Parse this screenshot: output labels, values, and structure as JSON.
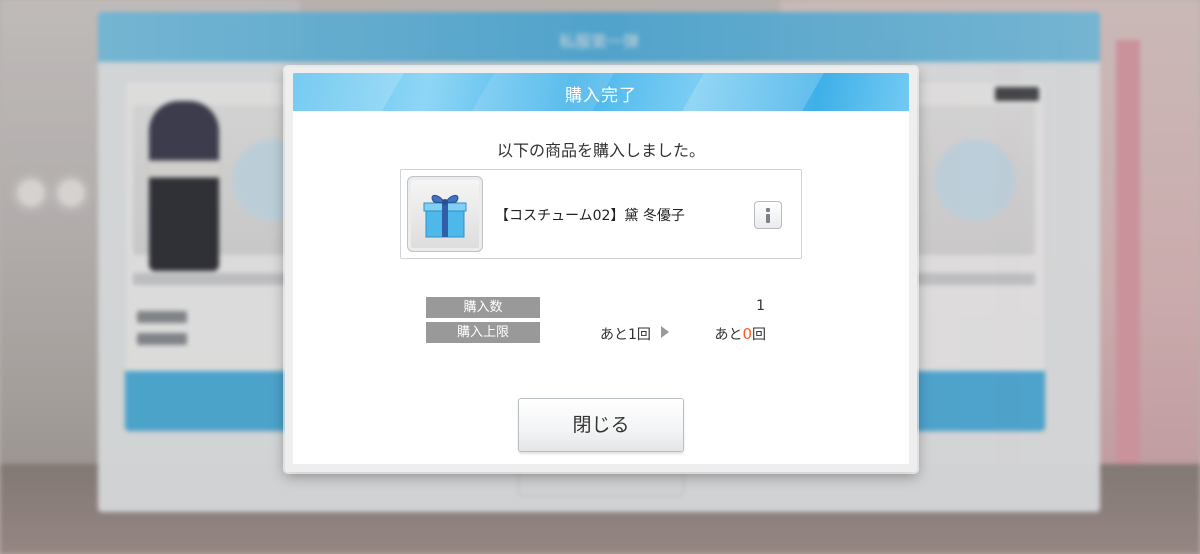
{
  "background": {
    "shop_title": "私服第一弾",
    "bg_close_label": "閉じる"
  },
  "dialog": {
    "title": "購入完了",
    "message": "以下の商品を購入しました。",
    "item": {
      "name": "【コスチューム02】黛 冬優子",
      "icon": "gift-box-icon"
    },
    "quantity": {
      "label": "購入数",
      "value": "1"
    },
    "limit": {
      "label": "購入上限",
      "before": "あと1回",
      "after_prefix": "あと",
      "after_count": "0",
      "after_suffix": "回"
    },
    "close_label": "閉じる"
  },
  "colors": {
    "header_blue": "#4fb7ea",
    "label_gray": "#999999",
    "zero_orange": "#ff5a1f"
  }
}
